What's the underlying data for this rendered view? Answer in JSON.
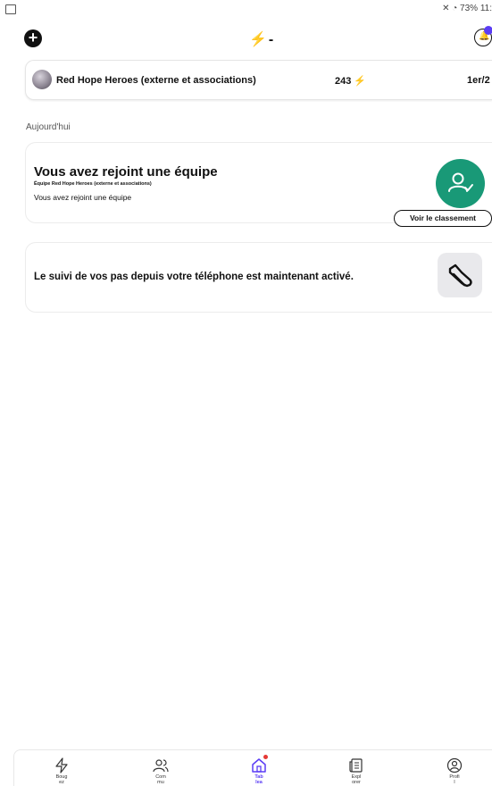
{
  "status": {
    "right_text": "73% 11:"
  },
  "topbar": {
    "energy_value": "-"
  },
  "team_card": {
    "name": "Red Hope Heroes (externe et associations)",
    "score": "243",
    "rank": "1er/2"
  },
  "section": {
    "label": "Aujourd'hui"
  },
  "notifications": [
    {
      "title": "Vous avez rejoint une équipe",
      "team_line": "Équipe Red Hope Heroes (externe et associations)",
      "body": "Vous avez rejoint une équipe",
      "button_label": "Voir le classement",
      "icon": "person-check-icon",
      "icon_color": "#199977"
    },
    {
      "title": "Le suivi de vos pas depuis votre téléphone est maintenant activé.",
      "icon": "shoe-icon"
    }
  ],
  "bottom_nav": [
    {
      "label": "Boug\nez",
      "icon": "bolt-icon",
      "active": false
    },
    {
      "label": "Com\nmu",
      "icon": "community-icon",
      "active": false
    },
    {
      "label": "Tab\nlea",
      "icon": "home-icon",
      "active": true
    },
    {
      "label": "Expl\norer",
      "icon": "explore-icon",
      "active": false
    },
    {
      "label": "Profi\nl",
      "icon": "profile-icon",
      "active": false
    }
  ],
  "colors": {
    "accent": "#5b3df5",
    "energy": "#8b5cf6",
    "success": "#199977"
  }
}
